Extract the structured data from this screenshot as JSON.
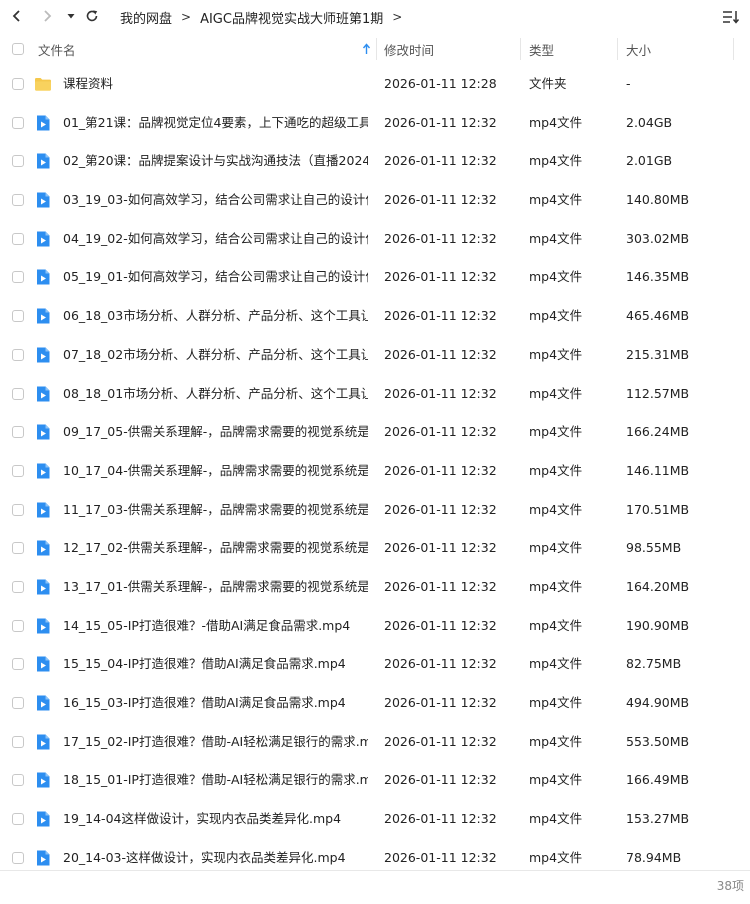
{
  "breadcrumb": {
    "items": [
      "我的网盘",
      "AIGC品牌视觉实战大师班第1期"
    ],
    "separator": ">"
  },
  "columns": {
    "name": "文件名",
    "modified": "修改时间",
    "type": "类型",
    "size": "大小"
  },
  "colors": {
    "folder": "#f5c84c",
    "video": "#2d8ef0",
    "sort_arrow": "#2d8ef0"
  },
  "files": [
    {
      "icon": "folder-icon",
      "name": "课程资料",
      "modified": "2026-01-11 12:28",
      "type": "文件夹",
      "size": "-"
    },
    {
      "icon": "video-file-icon",
      "name": "01_第21课：品牌视觉定位4要素，上下通吃的超级工具（...",
      "modified": "2026-01-11 12:32",
      "type": "mp4文件",
      "size": "2.04GB"
    },
    {
      "icon": "video-file-icon",
      "name": "02_第20课：品牌提案设计与实战沟通技法（直播2024_0...",
      "modified": "2026-01-11 12:32",
      "type": "mp4文件",
      "size": "2.01GB"
    },
    {
      "icon": "video-file-icon",
      "name": "03_19_03-如何高效学习，结合公司需求让自己的设计作...",
      "modified": "2026-01-11 12:32",
      "type": "mp4文件",
      "size": "140.80MB"
    },
    {
      "icon": "video-file-icon",
      "name": "04_19_02-如何高效学习，结合公司需求让自己的设计作...",
      "modified": "2026-01-11 12:32",
      "type": "mp4文件",
      "size": "303.02MB"
    },
    {
      "icon": "video-file-icon",
      "name": "05_19_01-如何高效学习，结合公司需求让自己的设计作...",
      "modified": "2026-01-11 12:32",
      "type": "mp4文件",
      "size": "146.35MB"
    },
    {
      "icon": "video-file-icon",
      "name": "06_18_03市场分析、人群分析、产品分析、这个工具让你...",
      "modified": "2026-01-11 12:32",
      "type": "mp4文件",
      "size": "465.46MB"
    },
    {
      "icon": "video-file-icon",
      "name": "07_18_02市场分析、人群分析、产品分析、这个工具让你...",
      "modified": "2026-01-11 12:32",
      "type": "mp4文件",
      "size": "215.31MB"
    },
    {
      "icon": "video-file-icon",
      "name": "08_18_01市场分析、人群分析、产品分析、这个工具让你...",
      "modified": "2026-01-11 12:32",
      "type": "mp4文件",
      "size": "112.57MB"
    },
    {
      "icon": "video-file-icon",
      "name": "09_17_05-供需关系理解-，品牌需求需要的视觉系统是什...",
      "modified": "2026-01-11 12:32",
      "type": "mp4文件",
      "size": "166.24MB"
    },
    {
      "icon": "video-file-icon",
      "name": "10_17_04-供需关系理解-，品牌需求需要的视觉系统是什...",
      "modified": "2026-01-11 12:32",
      "type": "mp4文件",
      "size": "146.11MB"
    },
    {
      "icon": "video-file-icon",
      "name": "11_17_03-供需关系理解-，品牌需求需要的视觉系统是什...",
      "modified": "2026-01-11 12:32",
      "type": "mp4文件",
      "size": "170.51MB"
    },
    {
      "icon": "video-file-icon",
      "name": "12_17_02-供需关系理解-，品牌需求需要的视觉系统是什...",
      "modified": "2026-01-11 12:32",
      "type": "mp4文件",
      "size": "98.55MB"
    },
    {
      "icon": "video-file-icon",
      "name": "13_17_01-供需关系理解-，品牌需求需要的视觉系统是什...",
      "modified": "2026-01-11 12:32",
      "type": "mp4文件",
      "size": "164.20MB"
    },
    {
      "icon": "video-file-icon",
      "name": "14_15_05-IP打造很难？-借助AI满足食品需求.mp4",
      "modified": "2026-01-11 12:32",
      "type": "mp4文件",
      "size": "190.90MB"
    },
    {
      "icon": "video-file-icon",
      "name": "15_15_04-IP打造很难？借助AI满足食品需求.mp4",
      "modified": "2026-01-11 12:32",
      "type": "mp4文件",
      "size": "82.75MB"
    },
    {
      "icon": "video-file-icon",
      "name": "16_15_03-IP打造很难？借助AI满足食品需求.mp4",
      "modified": "2026-01-11 12:32",
      "type": "mp4文件",
      "size": "494.90MB"
    },
    {
      "icon": "video-file-icon",
      "name": "17_15_02-IP打造很难？借助-AI轻松满足银行的需求.mp4",
      "modified": "2026-01-11 12:32",
      "type": "mp4文件",
      "size": "553.50MB"
    },
    {
      "icon": "video-file-icon",
      "name": "18_15_01-IP打造很难？借助-AI轻松满足银行的需求.mp4",
      "modified": "2026-01-11 12:32",
      "type": "mp4文件",
      "size": "166.49MB"
    },
    {
      "icon": "video-file-icon",
      "name": "19_14-04这样做设计，实现内衣品类差异化.mp4",
      "modified": "2026-01-11 12:32",
      "type": "mp4文件",
      "size": "153.27MB"
    },
    {
      "icon": "video-file-icon",
      "name": "20_14-03-这样做设计，实现内衣品类差异化.mp4",
      "modified": "2026-01-11 12:32",
      "type": "mp4文件",
      "size": "78.94MB"
    }
  ],
  "footer": {
    "item_count": "38项"
  }
}
